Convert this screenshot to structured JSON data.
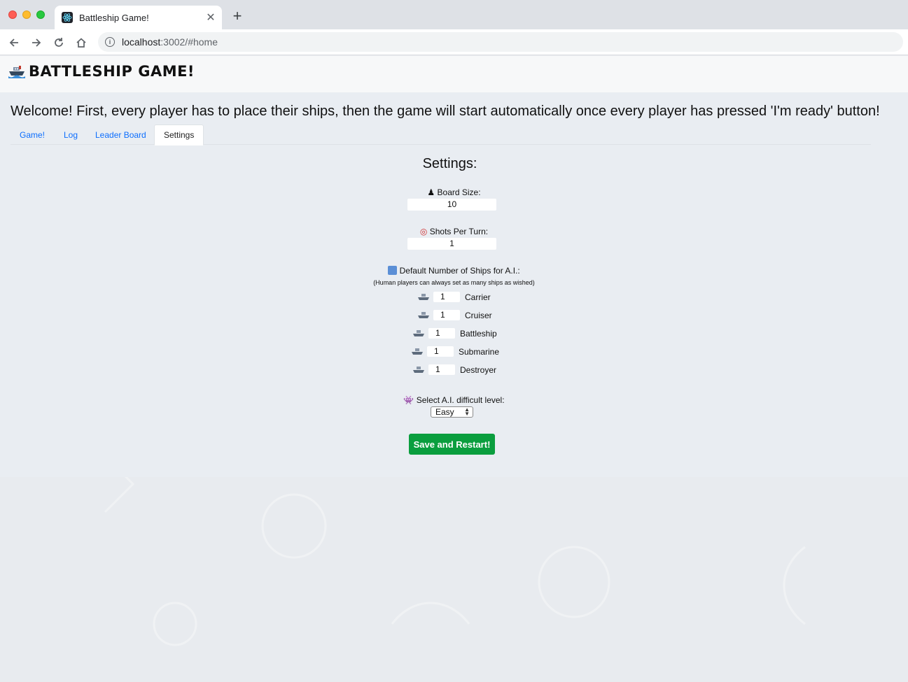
{
  "browser": {
    "tab_title": "Battleship Game!",
    "url_host": "localhost",
    "url_rest": ":3002/#home"
  },
  "header": {
    "title": "Battleship Game!",
    "logo_icon": "ship-icon"
  },
  "main": {
    "welcome": "Welcome! First, every player has to place their ships, then the game will start automatically once every player has pressed 'I'm ready' button!",
    "tabs": [
      {
        "label": "Game!",
        "active": false
      },
      {
        "label": "Log",
        "active": false
      },
      {
        "label": "Leader Board",
        "active": false
      },
      {
        "label": "Settings",
        "active": true
      }
    ]
  },
  "settings": {
    "title": "Settings:",
    "board_size": {
      "icon": "chess-pawn-icon",
      "label": "Board Size:",
      "value": "10"
    },
    "shots_per_turn": {
      "icon": "target-icon",
      "label": "Shots Per Turn:",
      "value": "1"
    },
    "default_ships": {
      "icon": "numbers-icon",
      "label": "Default Number of Ships for A.I.:",
      "note": "(Human players can always set as many ships as wished)",
      "ships": [
        {
          "icon": "ship-icon",
          "count": "1",
          "name": "Carrier"
        },
        {
          "icon": "ship-icon",
          "count": "1",
          "name": "Cruiser"
        },
        {
          "icon": "ship-icon",
          "count": "1",
          "name": "Battleship"
        },
        {
          "icon": "ship-icon",
          "count": "1",
          "name": "Submarine"
        },
        {
          "icon": "ship-icon",
          "count": "1",
          "name": "Destroyer"
        }
      ]
    },
    "ai_level": {
      "icon": "alien-icon",
      "label": "Select A.I. difficult level:",
      "selected": "Easy"
    },
    "save_label": "Save and Restart!"
  },
  "colors": {
    "save_button": "#0a9e3e",
    "tab_link": "#0d6efd",
    "page_bg": "#e9edf2"
  }
}
